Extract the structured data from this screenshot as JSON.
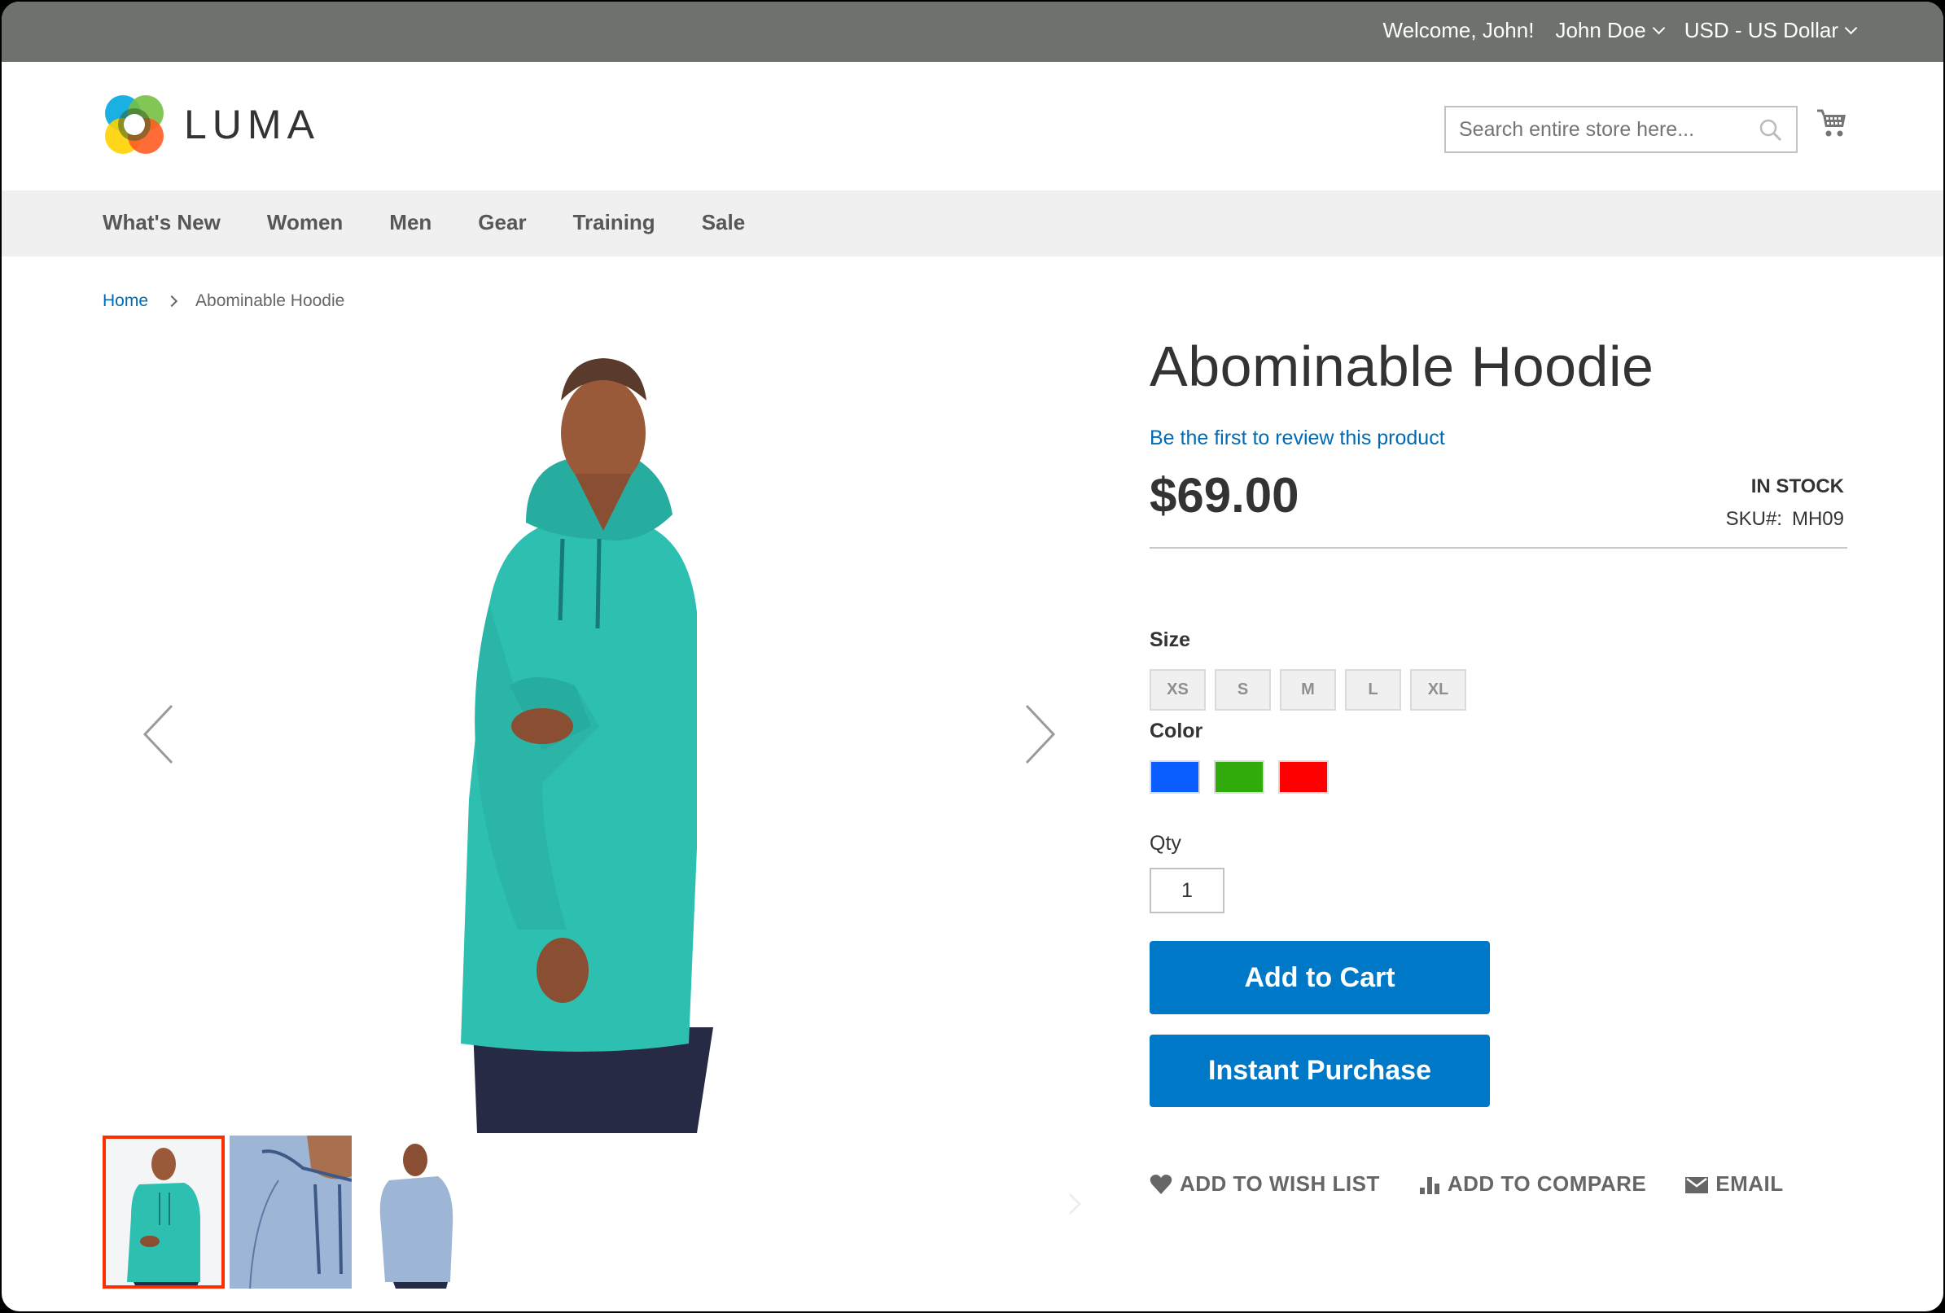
{
  "top_panel": {
    "welcome": "Welcome, John!",
    "account_menu": "John Doe",
    "currency_switcher": "USD - US Dollar"
  },
  "header": {
    "logo_text": "LUMA",
    "search": {
      "placeholder": "Search entire store here...",
      "value": ""
    },
    "icons": {
      "search": "search-icon",
      "cart": "cart-icon"
    }
  },
  "nav": {
    "items": [
      {
        "label": "What's New"
      },
      {
        "label": "Women"
      },
      {
        "label": "Men"
      },
      {
        "label": "Gear"
      },
      {
        "label": "Training"
      },
      {
        "label": "Sale"
      }
    ]
  },
  "breadcrumb": {
    "home": "Home",
    "current": "Abominable Hoodie"
  },
  "gallery": {
    "thumbnails": [
      {
        "alt": "Hoodie front view (teal)",
        "active": true
      },
      {
        "alt": "Hoodie detail close-up (light blue)",
        "active": false
      },
      {
        "alt": "Hoodie back view (light blue)",
        "active": false
      }
    ],
    "colors": {
      "active_thumb_border": "#ff2e00",
      "hoodie_teal": "#2dbfb0",
      "hoodie_blue": "#9db6d6"
    }
  },
  "product": {
    "name": "Abominable Hoodie",
    "review_link": "Be the first to review this product",
    "price": "$69.00",
    "stock_status": "IN STOCK",
    "sku_label": "SKU#:",
    "sku_value": "MH09",
    "size_label": "Size",
    "sizes": [
      "XS",
      "S",
      "M",
      "L",
      "XL"
    ],
    "color_label": "Color",
    "color_swatches": [
      {
        "name": "Blue",
        "hex": "#0a5eff"
      },
      {
        "name": "Green",
        "hex": "#31aa0c"
      },
      {
        "name": "Red",
        "hex": "#ff0000"
      }
    ],
    "qty_label": "Qty",
    "qty_value": "1",
    "add_to_cart": "Add to Cart",
    "instant_purchase": "Instant Purchase",
    "actions": {
      "wishlist": "Add to Wish List",
      "compare": "Add to Compare",
      "email": "Email"
    }
  },
  "theme": {
    "top_bar": "#6e726d",
    "nav_bg": "#f0f0f0",
    "link": "#006bb4",
    "primary_button": "#0078c8"
  }
}
